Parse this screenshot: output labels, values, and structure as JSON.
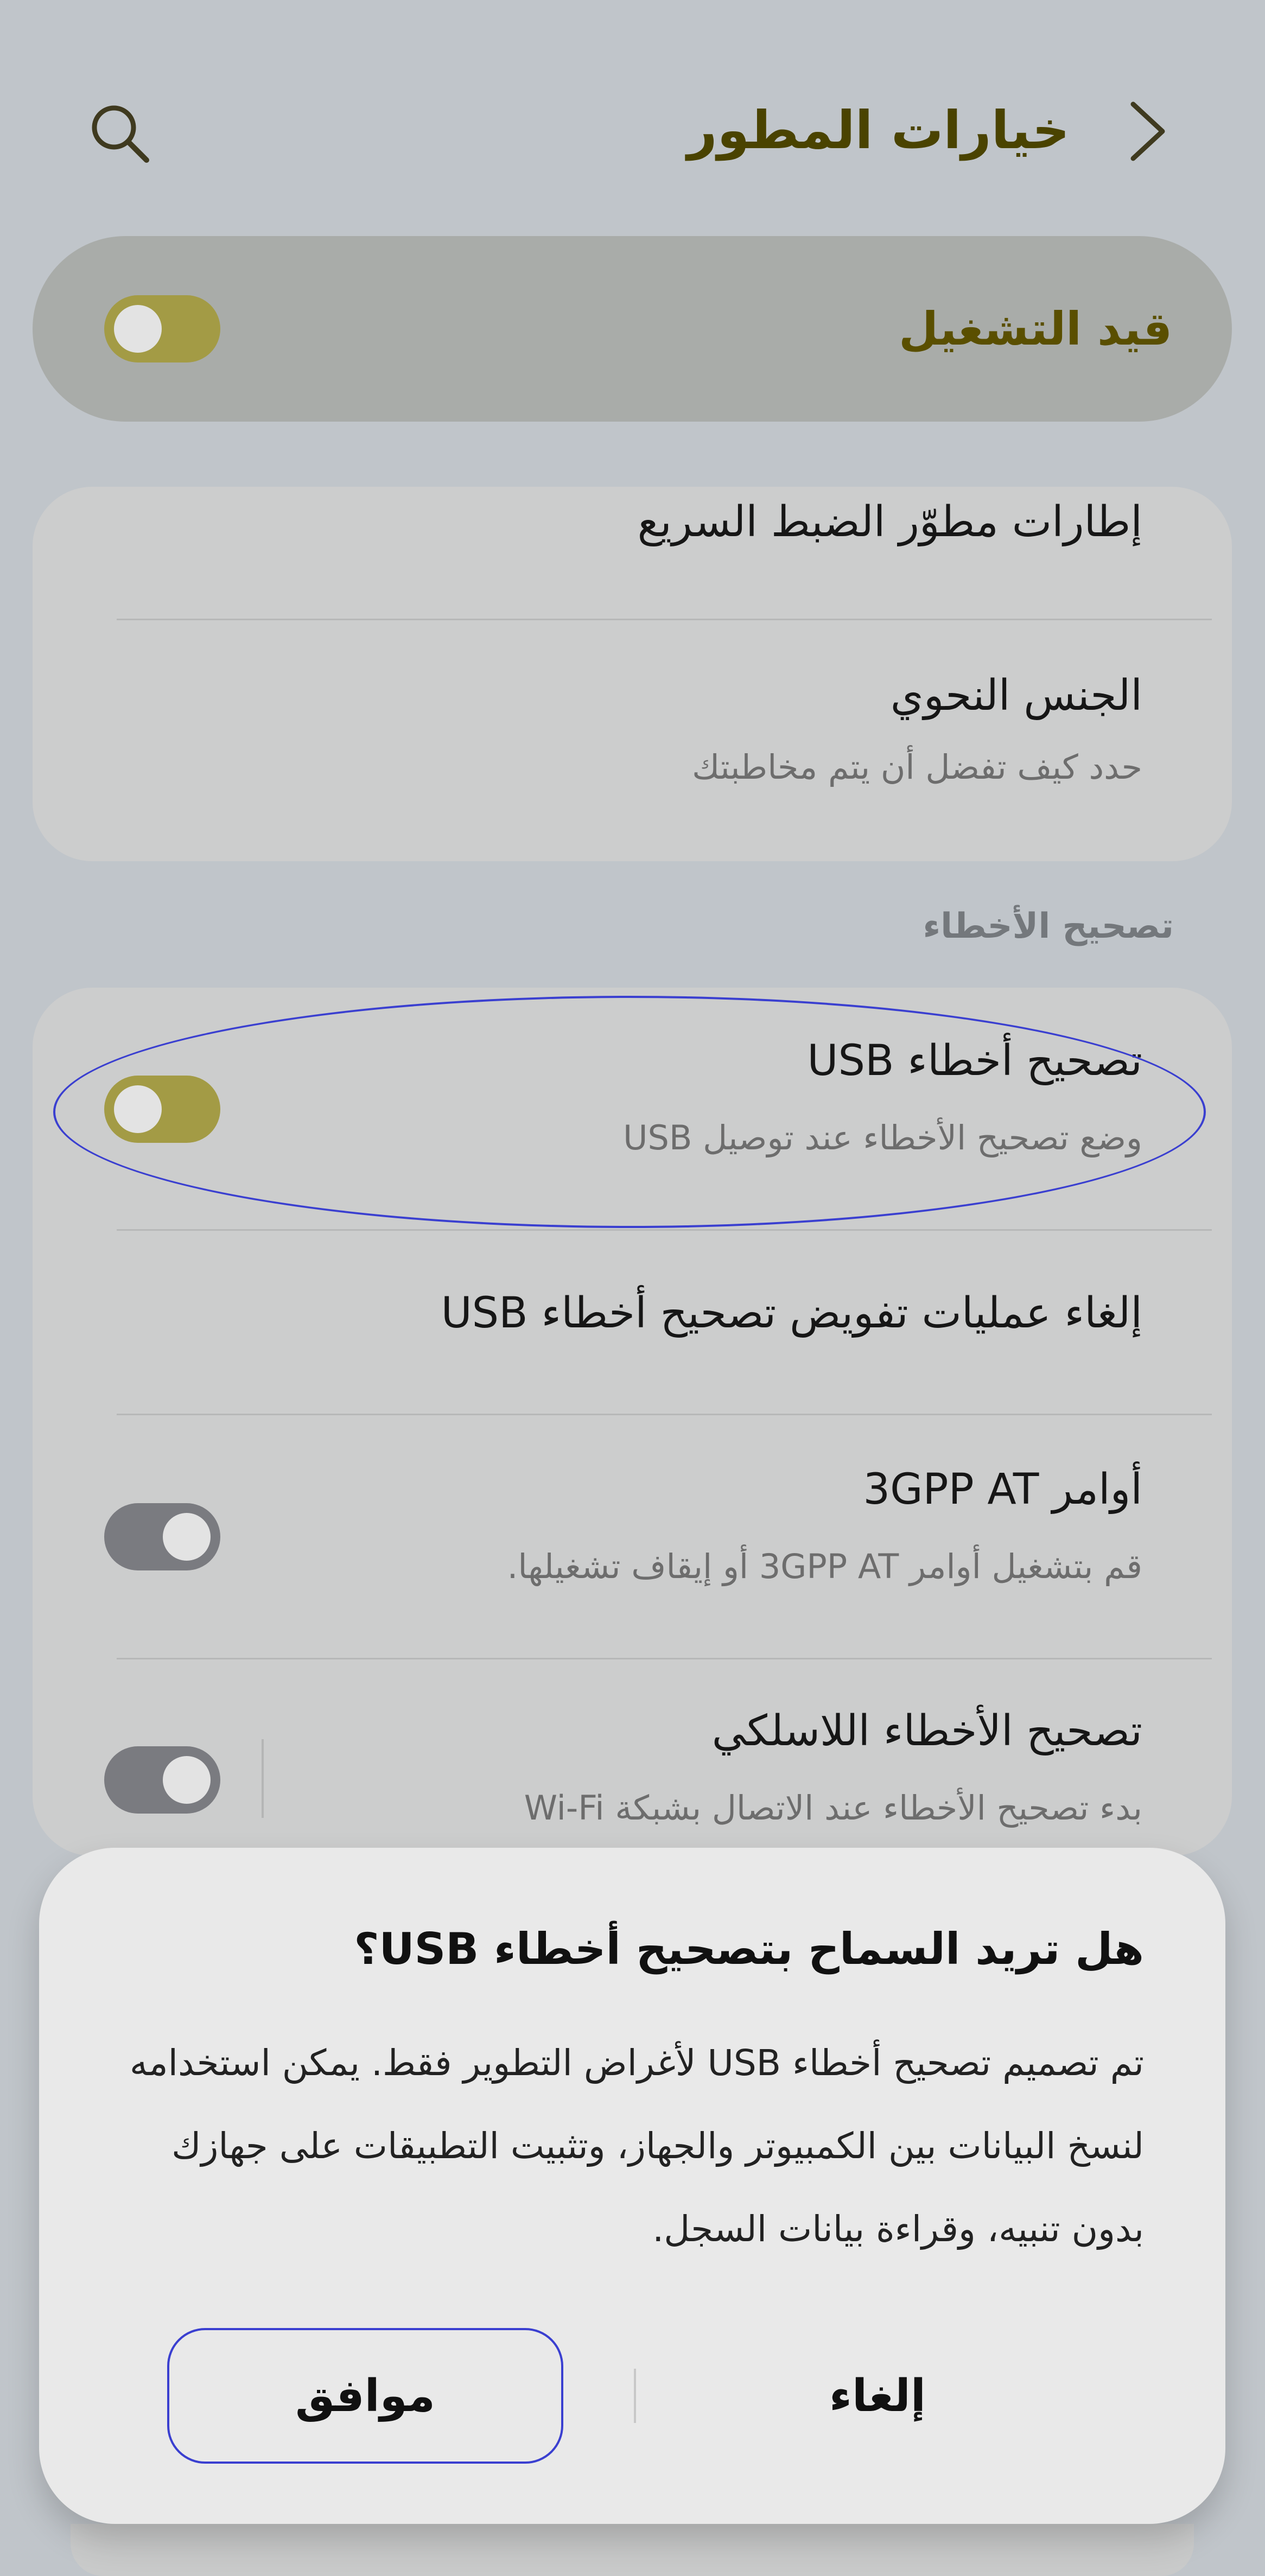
{
  "header": {
    "title": "خيارات المطور",
    "back_icon": "chevron-back-icon",
    "search_icon": "search-icon"
  },
  "master_switch": {
    "label": "قيد التشغيل",
    "state": "on"
  },
  "card1": {
    "quick_settings": {
      "title": "إطارات مطوّر الضبط السريع"
    },
    "grammatical_gender": {
      "title": "الجنس النحوي",
      "subtitle": "حدد كيف تفضل أن يتم مخاطبتك"
    }
  },
  "section": {
    "debugging": "تصحيح الأخطاء"
  },
  "card2": {
    "usb_debugging": {
      "title": "تصحيح أخطاء USB",
      "subtitle": "وضع تصحيح الأخطاء عند توصيل USB",
      "state": "on"
    },
    "revoke_usb": {
      "title": "إلغاء عمليات تفويض تصحيح أخطاء USB"
    },
    "at_commands": {
      "title": "أوامر 3GPP AT",
      "subtitle": "قم بتشغيل أوامر 3GPP AT أو إيقاف تشغيلها.",
      "state": "off"
    },
    "wireless_debugging": {
      "title": "تصحيح الأخطاء اللاسلكي",
      "subtitle": "بدء تصحيح الأخطاء عند الاتصال بشبكة Wi-Fi",
      "state": "off"
    }
  },
  "dialog": {
    "title": "هل تريد السماح بتصحيح أخطاء USB؟",
    "body_lines": [
      "تم تصميم تصحيح أخطاء USB لأغراض التطوير فقط. يمكن استخدامه",
      "لنسخ البيانات بين الكمبيوتر والجهاز، وتثبيت التطبيقات على جهازك",
      "بدون تنبيه، وقراءة بيانات السجل."
    ],
    "cancel_label": "إلغاء",
    "ok_label": "موافق"
  },
  "colors": {
    "accent": "#a39b45",
    "title_text": "#4a4300",
    "highlight_outline": "#3a3fd0",
    "background": "#c0c5ca"
  }
}
